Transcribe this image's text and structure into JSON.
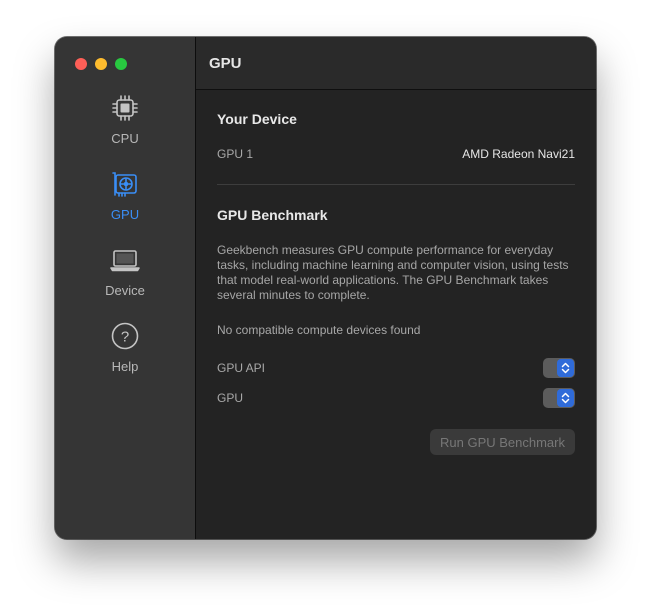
{
  "window": {
    "title": "GPU"
  },
  "sidebar": {
    "items": [
      {
        "label": "CPU",
        "icon": "cpu-chip-icon",
        "active": false
      },
      {
        "label": "GPU",
        "icon": "gpu-card-icon",
        "active": true
      },
      {
        "label": "Device",
        "icon": "laptop-icon",
        "active": false
      },
      {
        "label": "Help",
        "icon": "help-icon",
        "active": false
      }
    ]
  },
  "device": {
    "heading": "Your Device",
    "gpu_label": "GPU 1",
    "gpu_value": "AMD Radeon Navi21"
  },
  "benchmark": {
    "heading": "GPU Benchmark",
    "description": "Geekbench measures GPU compute performance for everyday tasks, including machine learning and computer vision, using tests that model real-world applications. The GPU Benchmark takes several minutes to complete.",
    "status": "No compatible compute devices found",
    "api_label": "GPU API",
    "gpu_label": "GPU",
    "run_button": "Run GPU Benchmark"
  },
  "colors": {
    "accent": "#3a8ef6",
    "sidebar_bg": "#353535",
    "content_bg": "#232323",
    "stepper_blue": "#2f6bd9"
  }
}
